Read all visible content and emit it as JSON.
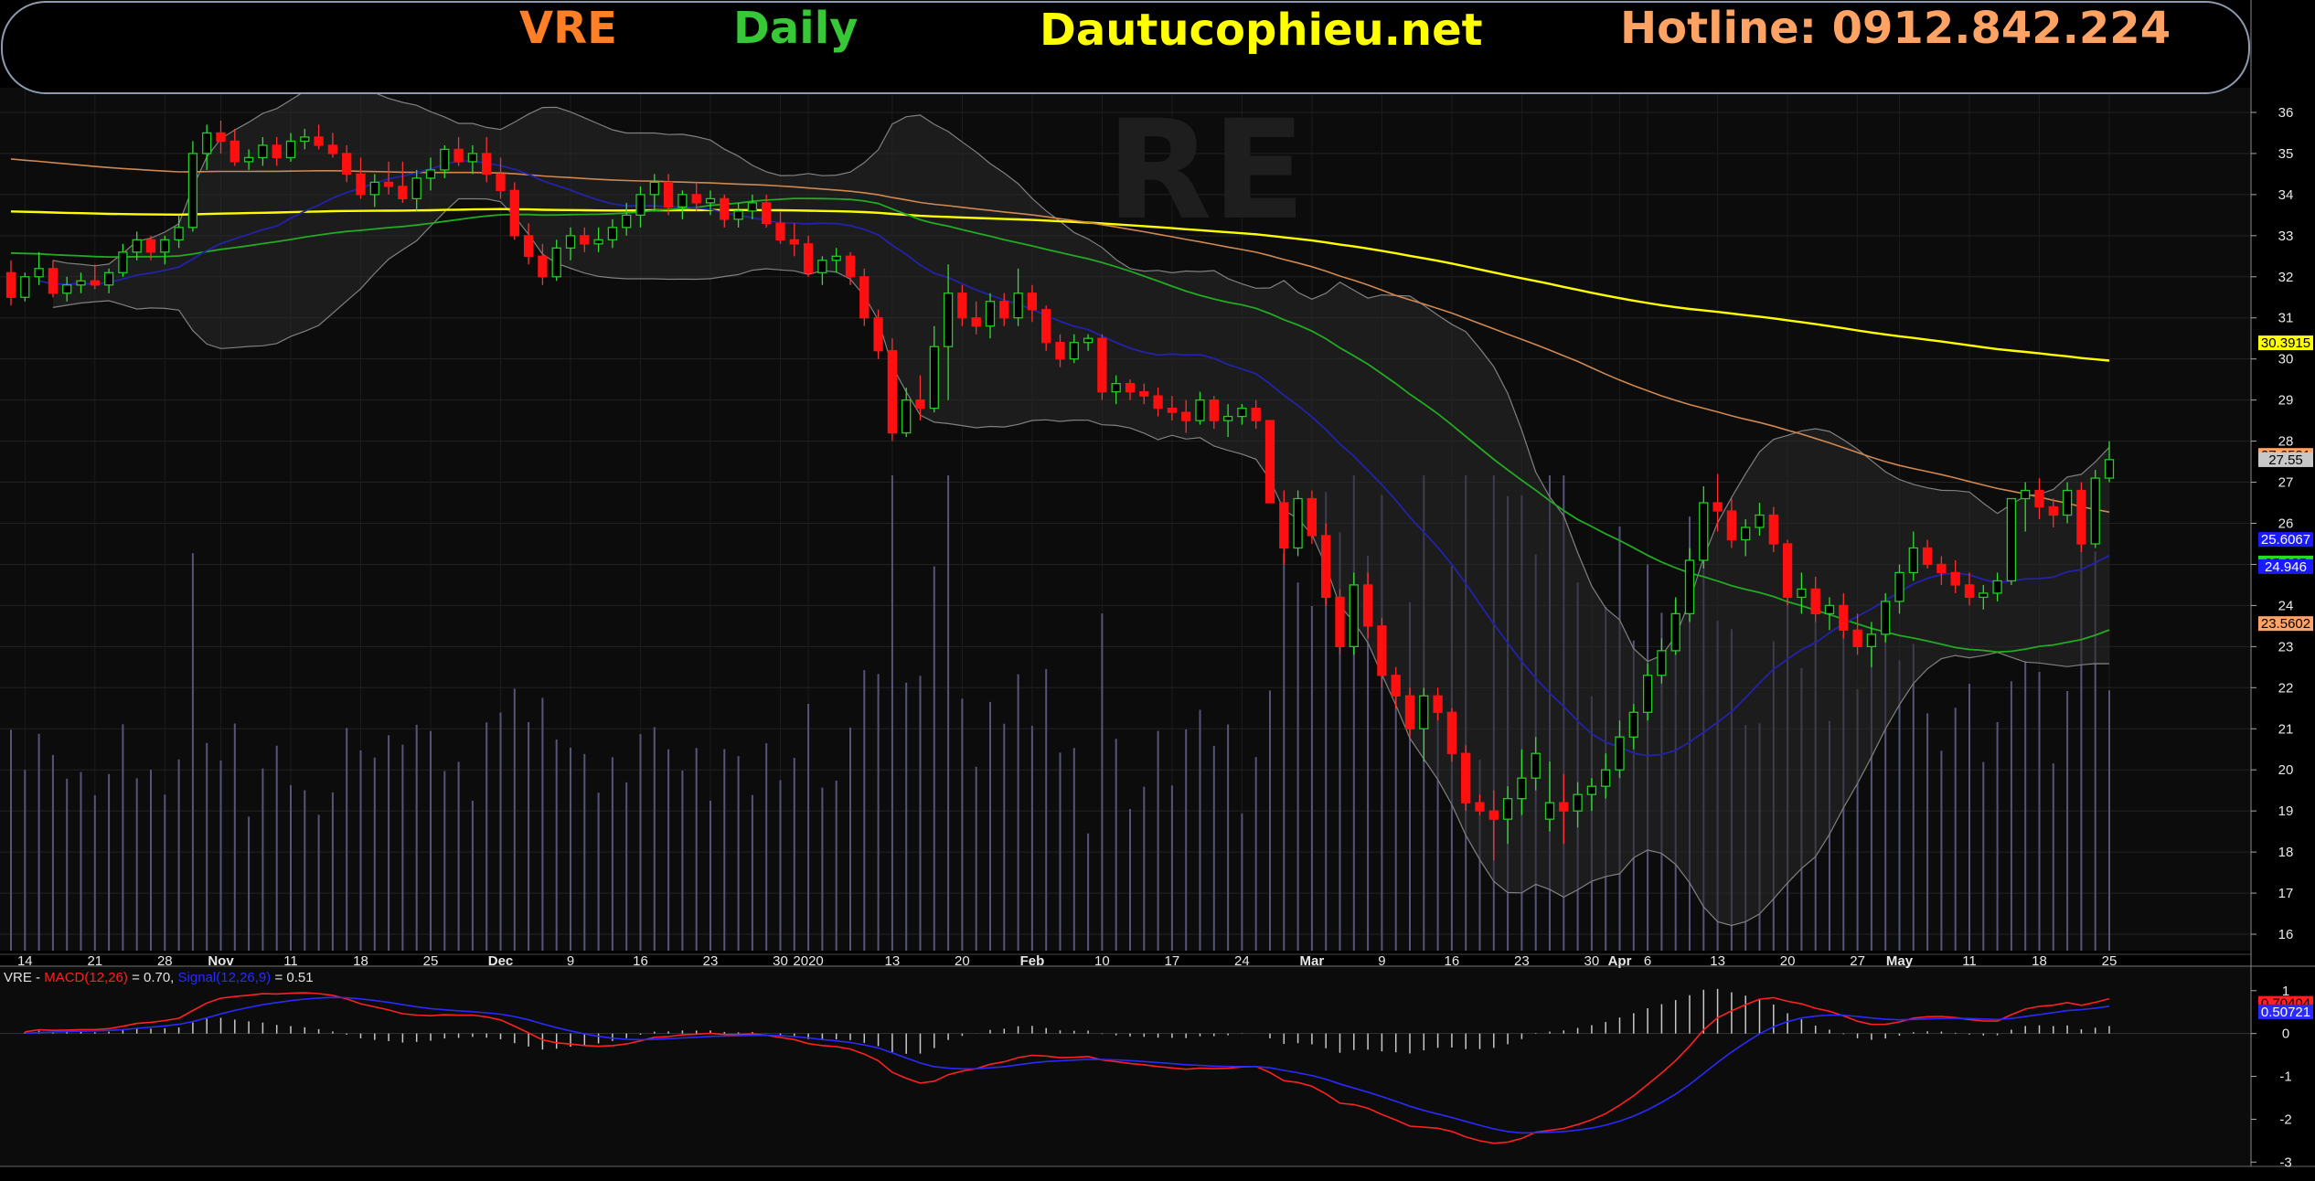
{
  "header": {
    "symbol": "VRE",
    "timeframe": "Daily",
    "site": "Dautucophieu.net",
    "hotline": "Hotline: 0912.842.224",
    "colors": {
      "symbol": "#ff7f27",
      "timeframe": "#37c837",
      "site": "#ffff00",
      "hotline": "#ffa365"
    }
  },
  "watermark": "RE",
  "chart_data": [
    {
      "type": "candlestick",
      "panel": "price",
      "ylim": [
        15.6,
        36.6
      ],
      "y_ticks": [
        16,
        17,
        18,
        19,
        20,
        21,
        22,
        23,
        24,
        25,
        26,
        27,
        28,
        29,
        30,
        31,
        32,
        33,
        34,
        35,
        36
      ],
      "x_ticks": [
        {
          "label": "14",
          "index": 1
        },
        {
          "label": "21",
          "index": 6
        },
        {
          "label": "28",
          "index": 11
        },
        {
          "label": "Nov",
          "index": 15
        },
        {
          "label": "11",
          "index": 20
        },
        {
          "label": "18",
          "index": 25
        },
        {
          "label": "25",
          "index": 30
        },
        {
          "label": "Dec",
          "index": 35
        },
        {
          "label": "9",
          "index": 40
        },
        {
          "label": "16",
          "index": 45
        },
        {
          "label": "23",
          "index": 50
        },
        {
          "label": "30",
          "index": 55
        },
        {
          "label": "2020",
          "index": 57
        },
        {
          "label": "13",
          "index": 63
        },
        {
          "label": "20",
          "index": 68
        },
        {
          "label": "Feb",
          "index": 73
        },
        {
          "label": "10",
          "index": 78
        },
        {
          "label": "17",
          "index": 83
        },
        {
          "label": "24",
          "index": 88
        },
        {
          "label": "Mar",
          "index": 93
        },
        {
          "label": "9",
          "index": 98
        },
        {
          "label": "16",
          "index": 103
        },
        {
          "label": "23",
          "index": 108
        },
        {
          "label": "30",
          "index": 113
        },
        {
          "label": "Apr",
          "index": 115
        },
        {
          "label": "6",
          "index": 117
        },
        {
          "label": "13",
          "index": 122
        },
        {
          "label": "20",
          "index": 127
        },
        {
          "label": "27",
          "index": 132
        },
        {
          "label": "May",
          "index": 135
        },
        {
          "label": "11",
          "index": 140
        },
        {
          "label": "18",
          "index": 145
        },
        {
          "label": "25",
          "index": 150
        }
      ],
      "candles": [
        [
          32.1,
          32.4,
          31.3,
          31.5
        ],
        [
          31.5,
          32.1,
          31.4,
          32.0
        ],
        [
          32.0,
          32.6,
          31.8,
          32.2
        ],
        [
          32.2,
          32.4,
          31.5,
          31.6
        ],
        [
          31.6,
          32.0,
          31.4,
          31.8
        ],
        [
          31.8,
          32.1,
          31.6,
          31.9
        ],
        [
          31.9,
          32.3,
          31.7,
          31.8
        ],
        [
          31.8,
          32.2,
          31.6,
          32.1
        ],
        [
          32.1,
          32.8,
          32.0,
          32.6
        ],
        [
          32.6,
          33.1,
          32.4,
          32.9
        ],
        [
          32.9,
          33.0,
          32.4,
          32.6
        ],
        [
          32.6,
          33.0,
          32.3,
          32.9
        ],
        [
          32.9,
          33.5,
          32.7,
          33.2
        ],
        [
          33.2,
          35.3,
          33.1,
          35.0
        ],
        [
          35.0,
          35.7,
          34.6,
          35.5
        ],
        [
          35.5,
          35.8,
          35.0,
          35.3
        ],
        [
          35.3,
          35.6,
          34.7,
          34.8
        ],
        [
          34.8,
          35.1,
          34.6,
          34.9
        ],
        [
          34.9,
          35.4,
          34.7,
          35.2
        ],
        [
          35.2,
          35.4,
          34.7,
          34.9
        ],
        [
          34.9,
          35.5,
          34.8,
          35.3
        ],
        [
          35.3,
          35.6,
          35.1,
          35.4
        ],
        [
          35.4,
          35.7,
          35.1,
          35.2
        ],
        [
          35.2,
          35.5,
          34.9,
          35.0
        ],
        [
          35.0,
          35.2,
          34.3,
          34.5
        ],
        [
          34.5,
          34.9,
          33.9,
          34.0
        ],
        [
          34.0,
          34.5,
          33.7,
          34.3
        ],
        [
          34.3,
          34.8,
          34.0,
          34.2
        ],
        [
          34.2,
          34.8,
          33.8,
          33.9
        ],
        [
          33.9,
          34.6,
          33.6,
          34.4
        ],
        [
          34.4,
          34.9,
          34.1,
          34.6
        ],
        [
          34.6,
          35.2,
          34.4,
          35.1
        ],
        [
          35.1,
          35.4,
          34.7,
          34.8
        ],
        [
          34.8,
          35.2,
          34.5,
          35.0
        ],
        [
          35.0,
          35.4,
          34.3,
          34.5
        ],
        [
          34.5,
          34.9,
          33.9,
          34.1
        ],
        [
          34.1,
          34.3,
          32.9,
          33.0
        ],
        [
          33.0,
          33.3,
          32.3,
          32.5
        ],
        [
          32.5,
          32.8,
          31.8,
          32.0
        ],
        [
          32.0,
          32.9,
          31.9,
          32.7
        ],
        [
          32.7,
          33.2,
          32.4,
          33.0
        ],
        [
          33.0,
          33.2,
          32.6,
          32.8
        ],
        [
          32.8,
          33.2,
          32.6,
          32.9
        ],
        [
          32.9,
          33.4,
          32.7,
          33.2
        ],
        [
          33.2,
          33.8,
          33.0,
          33.5
        ],
        [
          33.5,
          34.2,
          33.2,
          34.0
        ],
        [
          34.0,
          34.5,
          33.6,
          34.3
        ],
        [
          34.3,
          34.5,
          33.5,
          33.7
        ],
        [
          33.7,
          34.1,
          33.4,
          34.0
        ],
        [
          34.0,
          34.3,
          33.6,
          33.8
        ],
        [
          33.8,
          34.1,
          33.5,
          33.9
        ],
        [
          33.9,
          34.0,
          33.2,
          33.4
        ],
        [
          33.4,
          33.8,
          33.2,
          33.6
        ],
        [
          33.6,
          34.0,
          33.4,
          33.8
        ],
        [
          33.8,
          34.0,
          33.2,
          33.3
        ],
        [
          33.3,
          33.6,
          32.8,
          32.9
        ],
        [
          32.9,
          33.3,
          32.5,
          32.8
        ],
        [
          32.8,
          33.0,
          32.0,
          32.1
        ],
        [
          32.1,
          32.5,
          31.8,
          32.4
        ],
        [
          32.4,
          32.7,
          32.1,
          32.5
        ],
        [
          32.5,
          32.6,
          31.8,
          32.0
        ],
        [
          32.0,
          32.2,
          30.8,
          31.0
        ],
        [
          31.0,
          31.2,
          30.0,
          30.2
        ],
        [
          30.2,
          30.5,
          28.0,
          28.2
        ],
        [
          28.2,
          29.3,
          28.1,
          29.0
        ],
        [
          29.0,
          29.6,
          28.5,
          28.8
        ],
        [
          28.8,
          30.8,
          28.7,
          30.3
        ],
        [
          30.3,
          32.3,
          29.0,
          31.6
        ],
        [
          31.6,
          31.8,
          30.8,
          31.0
        ],
        [
          31.0,
          31.4,
          30.6,
          30.8
        ],
        [
          30.8,
          31.6,
          30.5,
          31.4
        ],
        [
          31.4,
          31.6,
          30.8,
          31.0
        ],
        [
          31.0,
          32.2,
          30.8,
          31.6
        ],
        [
          31.6,
          31.8,
          30.9,
          31.2
        ],
        [
          31.2,
          31.3,
          30.2,
          30.4
        ],
        [
          30.4,
          30.6,
          29.8,
          30.0
        ],
        [
          30.0,
          30.6,
          29.9,
          30.4
        ],
        [
          30.4,
          30.6,
          30.2,
          30.5
        ],
        [
          30.5,
          30.6,
          29.0,
          29.2
        ],
        [
          29.2,
          29.6,
          28.9,
          29.4
        ],
        [
          29.4,
          29.5,
          29.0,
          29.2
        ],
        [
          29.2,
          29.4,
          28.9,
          29.1
        ],
        [
          29.1,
          29.3,
          28.6,
          28.8
        ],
        [
          28.8,
          29.1,
          28.5,
          28.7
        ],
        [
          28.7,
          29.0,
          28.2,
          28.5
        ],
        [
          28.5,
          29.2,
          28.4,
          29.0
        ],
        [
          29.0,
          29.1,
          28.3,
          28.5
        ],
        [
          28.5,
          28.9,
          28.1,
          28.6
        ],
        [
          28.6,
          28.9,
          28.4,
          28.8
        ],
        [
          28.8,
          29.0,
          28.3,
          28.5
        ],
        [
          28.5,
          27.4,
          26.5,
          26.5
        ],
        [
          26.5,
          26.8,
          25.0,
          25.4
        ],
        [
          25.4,
          26.8,
          25.2,
          26.6
        ],
        [
          26.6,
          26.8,
          25.5,
          25.7
        ],
        [
          25.7,
          26.0,
          24.0,
          24.2
        ],
        [
          24.2,
          24.4,
          22.8,
          23.0
        ],
        [
          23.0,
          24.8,
          22.8,
          24.5
        ],
        [
          24.5,
          24.8,
          23.2,
          23.5
        ],
        [
          23.5,
          23.7,
          22.0,
          22.3
        ],
        [
          22.3,
          22.5,
          21.5,
          21.8
        ],
        [
          21.8,
          22.0,
          20.8,
          21.0
        ],
        [
          21.0,
          22.0,
          20.2,
          21.8
        ],
        [
          21.8,
          22.0,
          21.2,
          21.4
        ],
        [
          21.4,
          21.5,
          20.2,
          20.4
        ],
        [
          20.4,
          20.6,
          19.0,
          19.2
        ],
        [
          19.2,
          19.4,
          18.9,
          19.0
        ],
        [
          19.0,
          19.5,
          17.8,
          18.8
        ],
        [
          18.8,
          19.6,
          18.2,
          19.3
        ],
        [
          19.3,
          20.5,
          18.9,
          19.8
        ],
        [
          19.8,
          20.8,
          19.5,
          20.4
        ],
        [
          18.8,
          20.2,
          18.5,
          19.2
        ],
        [
          19.2,
          19.9,
          18.2,
          19.0
        ],
        [
          19.0,
          19.7,
          18.6,
          19.4
        ],
        [
          19.4,
          19.8,
          19.0,
          19.6
        ],
        [
          19.6,
          20.4,
          19.3,
          20.0
        ],
        [
          20.0,
          21.2,
          19.8,
          20.8
        ],
        [
          20.8,
          21.6,
          20.5,
          21.4
        ],
        [
          21.4,
          22.6,
          21.2,
          22.3
        ],
        [
          22.3,
          23.2,
          22.1,
          22.9
        ],
        [
          22.9,
          24.2,
          22.8,
          23.8
        ],
        [
          23.8,
          25.4,
          23.6,
          25.1
        ],
        [
          25.1,
          26.9,
          24.9,
          26.5
        ],
        [
          26.5,
          27.2,
          25.8,
          26.3
        ],
        [
          26.3,
          26.6,
          25.4,
          25.6
        ],
        [
          25.6,
          26.1,
          25.2,
          25.9
        ],
        [
          25.9,
          26.5,
          25.7,
          26.2
        ],
        [
          26.2,
          26.4,
          25.3,
          25.5
        ],
        [
          25.5,
          25.6,
          24.0,
          24.2
        ],
        [
          24.2,
          24.8,
          23.8,
          24.4
        ],
        [
          24.4,
          24.7,
          23.6,
          23.8
        ],
        [
          23.8,
          24.2,
          23.4,
          24.0
        ],
        [
          24.0,
          24.3,
          23.2,
          23.4
        ],
        [
          23.4,
          23.8,
          22.8,
          23.0
        ],
        [
          23.0,
          23.6,
          22.5,
          23.3
        ],
        [
          23.3,
          24.3,
          23.1,
          24.1
        ],
        [
          24.1,
          25.0,
          23.8,
          24.8
        ],
        [
          24.8,
          25.8,
          24.6,
          25.4
        ],
        [
          25.4,
          25.6,
          24.9,
          25.0
        ],
        [
          25.0,
          25.2,
          24.5,
          24.8
        ],
        [
          24.8,
          25.1,
          24.3,
          24.5
        ],
        [
          24.5,
          24.8,
          24.0,
          24.2
        ],
        [
          24.2,
          24.5,
          23.9,
          24.3
        ],
        [
          24.3,
          24.8,
          24.1,
          24.6
        ],
        [
          24.6,
          25.7,
          24.5,
          26.6
        ],
        [
          26.6,
          27.0,
          25.8,
          26.8
        ],
        [
          26.8,
          27.1,
          26.1,
          26.4
        ],
        [
          26.4,
          26.6,
          25.9,
          26.2
        ],
        [
          26.2,
          27.0,
          26.0,
          26.8
        ],
        [
          26.8,
          27.0,
          25.3,
          25.5
        ],
        [
          25.5,
          27.3,
          25.4,
          27.1
        ],
        [
          27.1,
          28.0,
          27.0,
          27.55
        ]
      ],
      "price_labels": [
        {
          "value": "30.3915",
          "color": "#ffff00",
          "text_color": "#000000"
        },
        {
          "value": "27.6531",
          "color": "#ffa366",
          "text_color": "#000000"
        },
        {
          "value": "27.55",
          "color": "#c8c8c8",
          "text_color": "#000000"
        },
        {
          "value": "27.55",
          "color": "#c8c8c8",
          "text_color": "#000000"
        },
        {
          "value": "25.6067",
          "color": "#1a1aff",
          "text_color": "#ffffff"
        },
        {
          "value": "25.035",
          "color": "#22dd22",
          "text_color": "#000000"
        },
        {
          "value": "24.946",
          "color": "#1a1aff",
          "text_color": "#ffffff"
        },
        {
          "value": "23.5602",
          "color": "#ffa366",
          "text_color": "#000000"
        }
      ],
      "indicators": {
        "ma_long_color": "#ffff00",
        "ma_mid_color": "#d08850",
        "ma_green_color": "#22aa22",
        "ma_blue_color": "#2222aa",
        "bollinger_color": "#808080"
      }
    },
    {
      "type": "line",
      "panel": "macd",
      "ylim": [
        -3.1,
        1.55
      ],
      "y_ticks": [
        -3,
        -2,
        -1,
        0,
        1
      ],
      "legend": {
        "symbol": "VRE",
        "macd_label": "MACD(12,26)",
        "macd_value": "= 0.70,",
        "signal_label": "Signal(12,26,9)",
        "signal_value": "= 0.51",
        "macd_color": "#ff2020",
        "signal_color": "#2a2aff"
      },
      "value_labels": [
        {
          "value": "0.70404",
          "color": "#ff2020",
          "text_color": "#000000"
        },
        {
          "value": "0.50721",
          "color": "#2a2aff",
          "text_color": "#ffffff"
        }
      ]
    }
  ]
}
